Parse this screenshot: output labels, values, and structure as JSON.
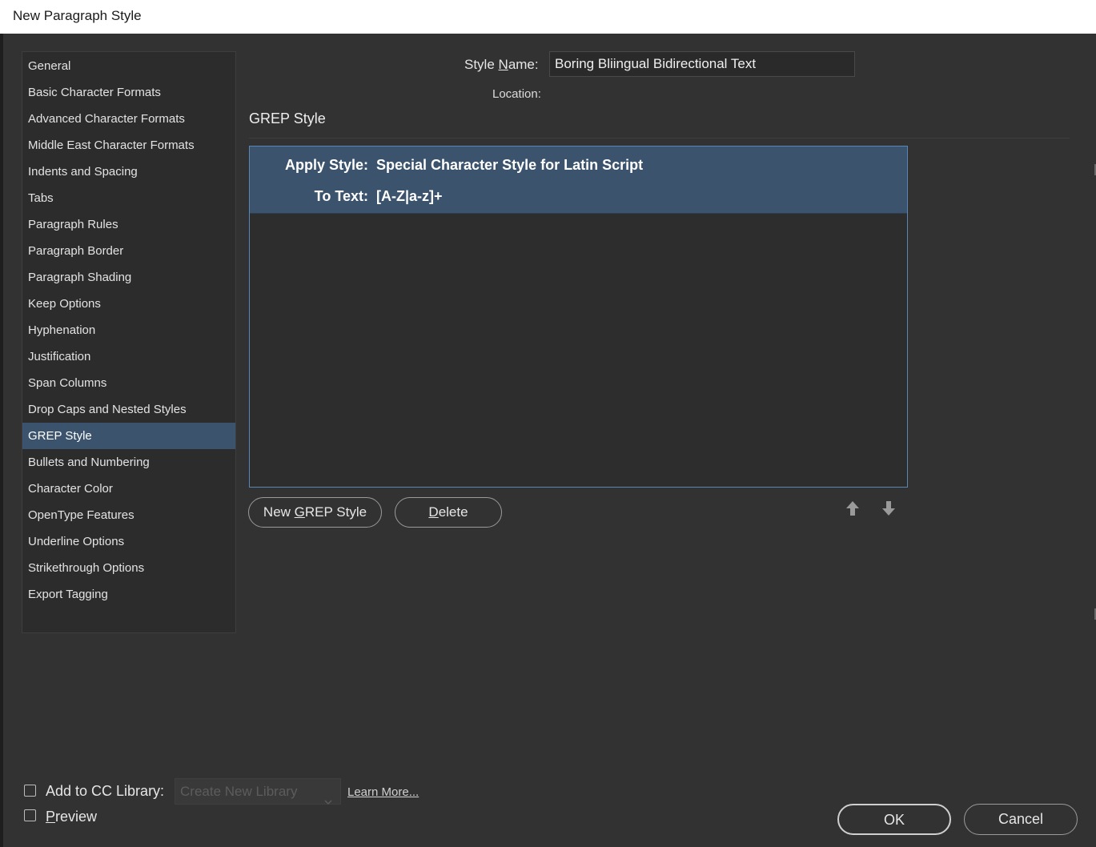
{
  "window": {
    "title": "New Paragraph Style"
  },
  "sidebar": {
    "items": [
      {
        "label": "General"
      },
      {
        "label": "Basic Character Formats"
      },
      {
        "label": "Advanced Character Formats"
      },
      {
        "label": "Middle East Character Formats"
      },
      {
        "label": "Indents and Spacing"
      },
      {
        "label": "Tabs"
      },
      {
        "label": "Paragraph Rules"
      },
      {
        "label": "Paragraph Border"
      },
      {
        "label": "Paragraph Shading"
      },
      {
        "label": "Keep Options"
      },
      {
        "label": "Hyphenation"
      },
      {
        "label": "Justification"
      },
      {
        "label": "Span Columns"
      },
      {
        "label": "Drop Caps and Nested Styles"
      },
      {
        "label": "GREP Style"
      },
      {
        "label": "Bullets and Numbering"
      },
      {
        "label": "Character Color"
      },
      {
        "label": "OpenType Features"
      },
      {
        "label": "Underline Options"
      },
      {
        "label": "Strikethrough Options"
      },
      {
        "label": "Export Tagging"
      }
    ],
    "active_index": 14
  },
  "header": {
    "style_name_label_pre": "Style ",
    "style_name_label_u": "N",
    "style_name_label_post": "ame:",
    "style_name_value": "Boring Bliingual Bidirectional Text",
    "location_label": "Location:"
  },
  "section": {
    "title": "GREP Style"
  },
  "grep_rules": [
    {
      "apply_style_label": "Apply Style:",
      "apply_style_value": "Special Character Style for Latin Script",
      "to_text_label": "To Text:",
      "to_text_value": "[A-Z|a-z]+"
    }
  ],
  "buttons": {
    "new_grep_pre": "New ",
    "new_grep_u": "G",
    "new_grep_post": "REP Style",
    "delete_u": "D",
    "delete_post": "elete",
    "ok": "OK",
    "cancel": "Cancel"
  },
  "footer": {
    "add_to_cc_label": "Add to CC Library:",
    "add_to_cc_checked": false,
    "library_dropdown_value": "Create New Library",
    "learn_more": "Learn More...",
    "preview_u": "P",
    "preview_post": "review",
    "preview_checked": false
  },
  "icons": {
    "move_up": "arrow-up-icon",
    "move_down": "arrow-down-icon",
    "dropdown": "chevron-down-icon"
  },
  "colors": {
    "background": "#323232",
    "selection": "#3b536c",
    "list_border": "#5a86b5"
  }
}
